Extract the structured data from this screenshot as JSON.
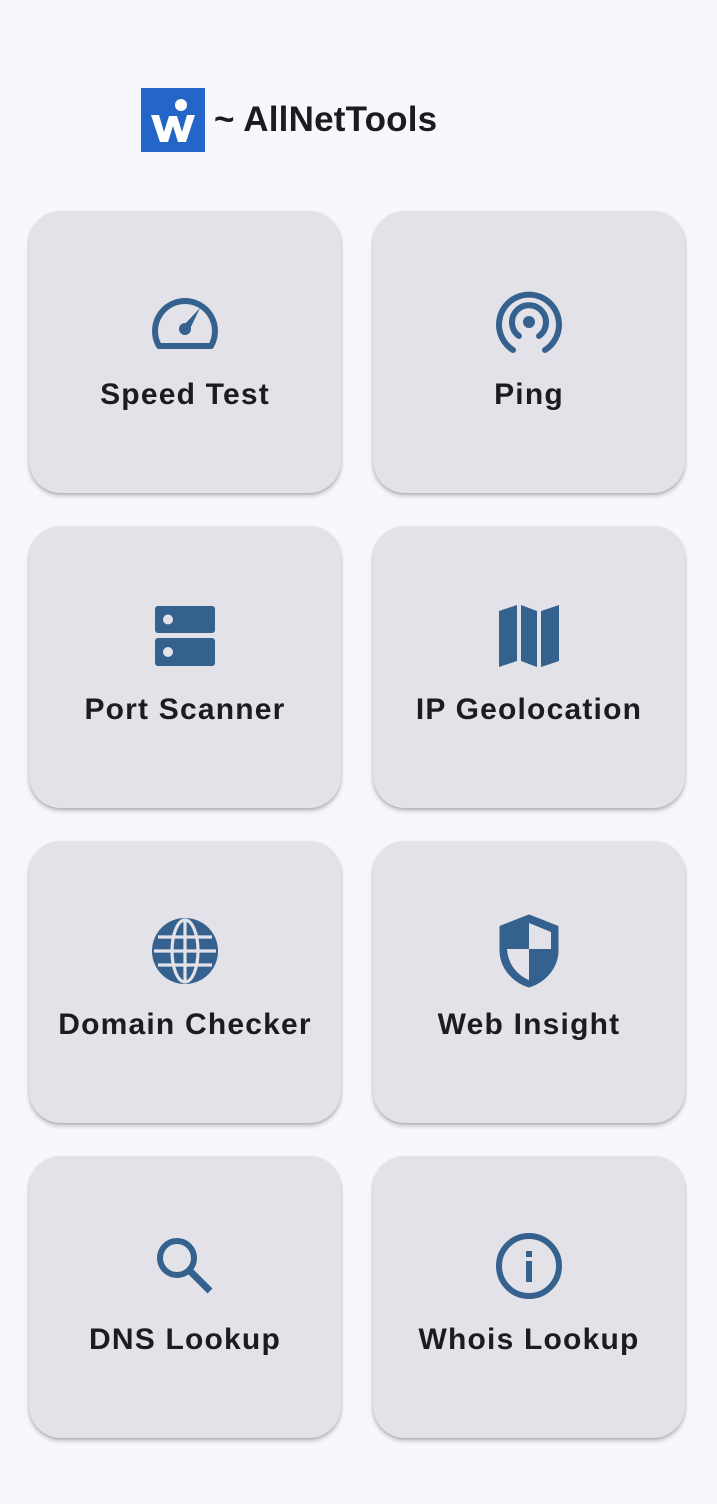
{
  "app": {
    "title": "~ AllNetTools",
    "logo_icon": "allnettools-logo",
    "colors": {
      "background": "#f6f8fd",
      "card": "#e2e2e8",
      "icon": "#35618f",
      "logo": "#2466c8",
      "text": "#1d1b20"
    }
  },
  "tools": [
    {
      "label": "Speed Test",
      "icon": "speedometer-icon"
    },
    {
      "label": "Ping",
      "icon": "broadcast-icon"
    },
    {
      "label": "Port Scanner",
      "icon": "server-icon"
    },
    {
      "label": "IP Geolocation",
      "icon": "map-icon"
    },
    {
      "label": "Domain Checker",
      "icon": "globe-icon"
    },
    {
      "label": "Web Insight",
      "icon": "shield-icon"
    },
    {
      "label": "DNS Lookup",
      "icon": "search-icon"
    },
    {
      "label": "Whois Lookup",
      "icon": "info-icon"
    }
  ]
}
